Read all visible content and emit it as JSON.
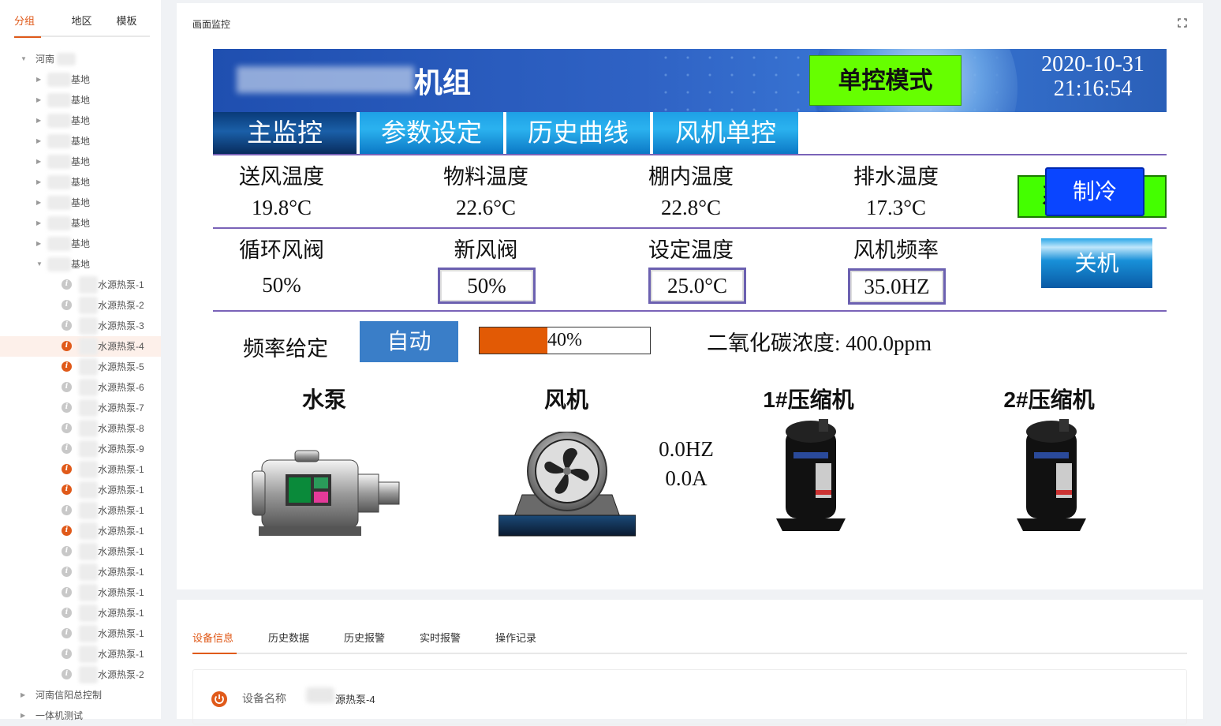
{
  "sidebar": {
    "tabs": [
      "分组",
      "地区",
      "模板"
    ],
    "tree": [
      {
        "label": "河南",
        "level": 0,
        "arrow": "▼"
      },
      {
        "label": "基地",
        "level": 1,
        "arrow": "▶"
      },
      {
        "label": "基地",
        "level": 1,
        "arrow": "▶"
      },
      {
        "label": "基地",
        "level": 1,
        "arrow": "▶"
      },
      {
        "label": "基地",
        "level": 1,
        "arrow": "▶"
      },
      {
        "label": "基地",
        "level": 1,
        "arrow": "▶"
      },
      {
        "label": "基地",
        "level": 1,
        "arrow": "▶"
      },
      {
        "label": "基地",
        "level": 1,
        "arrow": "▶"
      },
      {
        "label": "基地",
        "level": 1,
        "arrow": "▶"
      },
      {
        "label": "基地",
        "level": 1,
        "arrow": "▶"
      },
      {
        "label": "基地",
        "level": 1,
        "arrow": "▼"
      },
      {
        "label": "水源热泵-1",
        "level": 2,
        "status": "normal"
      },
      {
        "label": "水源热泵-2",
        "level": 2,
        "status": "normal"
      },
      {
        "label": "水源热泵-3",
        "level": 2,
        "status": "normal"
      },
      {
        "label": "水源热泵-4",
        "level": 2,
        "status": "alarm",
        "selected": true
      },
      {
        "label": "水源热泵-5",
        "level": 2,
        "status": "alarm"
      },
      {
        "label": "水源热泵-6",
        "level": 2,
        "status": "normal"
      },
      {
        "label": "水源热泵-7",
        "level": 2,
        "status": "normal"
      },
      {
        "label": "水源热泵-8",
        "level": 2,
        "status": "normal"
      },
      {
        "label": "水源热泵-9",
        "level": 2,
        "status": "normal"
      },
      {
        "label": "水源热泵-1",
        "level": 2,
        "status": "alarm"
      },
      {
        "label": "水源热泵-1",
        "level": 2,
        "status": "alarm"
      },
      {
        "label": "水源热泵-1",
        "level": 2,
        "status": "normal"
      },
      {
        "label": "水源热泵-1",
        "level": 2,
        "status": "alarm"
      },
      {
        "label": "水源热泵-1",
        "level": 2,
        "status": "normal"
      },
      {
        "label": "水源热泵-1",
        "level": 2,
        "status": "normal"
      },
      {
        "label": "水源热泵-1",
        "level": 2,
        "status": "normal"
      },
      {
        "label": "水源热泵-1",
        "level": 2,
        "status": "normal"
      },
      {
        "label": "水源热泵-1",
        "level": 2,
        "status": "normal"
      },
      {
        "label": "水源热泵-1",
        "level": 2,
        "status": "normal"
      },
      {
        "label": "水源热泵-2",
        "level": 2,
        "status": "normal"
      },
      {
        "label": "河南信阳总控制",
        "level": 0,
        "arrow": "▶"
      },
      {
        "label": "一体机测试",
        "level": 0,
        "arrow": "▶"
      }
    ]
  },
  "panel": {
    "title": "画面监控"
  },
  "hmi": {
    "title_suffix": "机组",
    "mode_button": "单控模式",
    "date": "2020-10-31",
    "time": "21:16:54",
    "nav": [
      "主监控",
      "参数设定",
      "历史曲线",
      "风机单控"
    ],
    "status": "系统正常",
    "row1": [
      {
        "label": "送风温度",
        "value": "19.8°C"
      },
      {
        "label": "物料温度",
        "value": "22.6°C"
      },
      {
        "label": "棚内温度",
        "value": "22.8°C"
      },
      {
        "label": "排水温度",
        "value": "17.3°C"
      }
    ],
    "row2": [
      {
        "label": "循环风阀",
        "value": "50%"
      },
      {
        "label": "新风阀",
        "value": "50%"
      },
      {
        "label": "设定温度",
        "value": "25.0°C"
      },
      {
        "label": "风机频率",
        "value": "35.0HZ"
      }
    ],
    "cool_button": "制冷",
    "off_button": "关机",
    "freq_label": "频率给定",
    "auto_button": "自动",
    "progress_text": "40%",
    "progress": 0.4,
    "co2_text": "二氧化碳浓度:  400.0ppm",
    "equipment": [
      "水泵",
      "风机",
      "1#压缩机",
      "2#压缩机"
    ],
    "fan_freq": "0.0HZ",
    "fan_current": "0.0A",
    "colors": {
      "mode": "#66ff00",
      "status": "#44ff00",
      "cool": "#0a45ff",
      "progress": "#e25a05"
    }
  },
  "bottom": {
    "tabs": [
      "设备信息",
      "历史数据",
      "历史报警",
      "实时报警",
      "操作记录"
    ],
    "device_label": "设备名称",
    "device_value": "源热泵-4"
  }
}
